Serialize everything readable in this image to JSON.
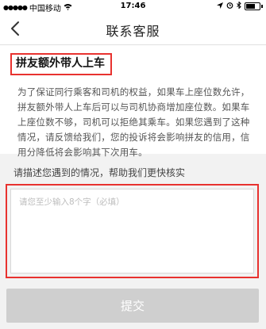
{
  "status_bar": {
    "carrier": "中国移动",
    "time": "17:46"
  },
  "header": {
    "title": "联系客服"
  },
  "topic": {
    "title": "拼友额外带人上车",
    "body": "为了保证同行乘客和司机的权益，如果车上座位数允许，拼友额外带人上车后可以与司机协商增加座位数。如果车上座位数不够，司机可以拒绝其乘车。如果您遇到了这种情况，请反馈给我们，您的投诉将会影响拼友的信用，信用分降低将会影响其下次用车。"
  },
  "form": {
    "label": "请描述您遇到的情况，帮助我们更快核实",
    "placeholder": "请您至少输入8个字（必填）",
    "value": ""
  },
  "submit_label": "提交",
  "colors": {
    "highlight_border": "#e8322f",
    "submit_disabled": "#cfcfcf"
  }
}
